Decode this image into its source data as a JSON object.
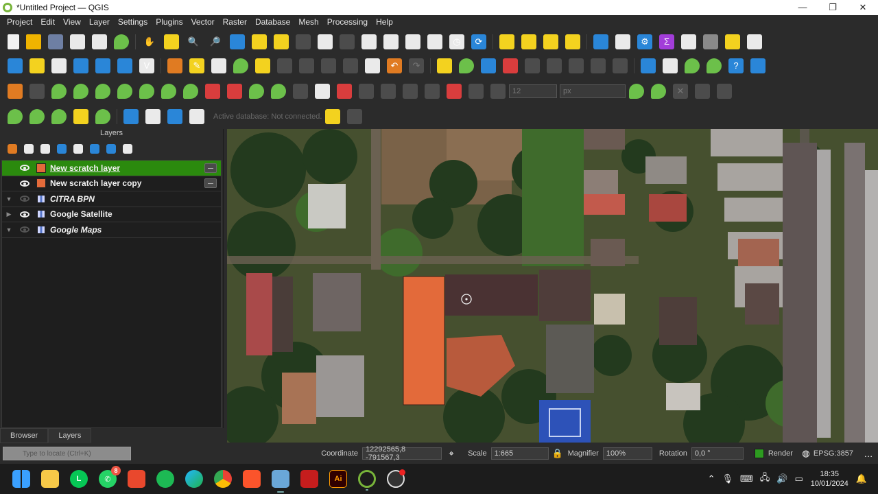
{
  "window": {
    "title": "*Untitled Project — QGIS",
    "min": "—",
    "max": "❐",
    "close": "✕"
  },
  "menu": [
    "Project",
    "Edit",
    "View",
    "Layer",
    "Settings",
    "Plugins",
    "Vector",
    "Raster",
    "Database",
    "Mesh",
    "Processing",
    "Help"
  ],
  "toolbar": {
    "spin_value": "12",
    "unit_value": "px",
    "active_database": "Active database: Not connected."
  },
  "layers_panel": {
    "title": "Layers",
    "layers": [
      {
        "name": "New scratch layer",
        "visible": true,
        "selected": true,
        "symbol": "orange",
        "editable": true,
        "italic": false
      },
      {
        "name": "New scratch layer copy",
        "visible": true,
        "selected": false,
        "symbol": "orange",
        "editable": true,
        "italic": false
      },
      {
        "name": "CITRA BPN",
        "visible": false,
        "selected": false,
        "symbol": "raster",
        "editable": false,
        "italic": true
      },
      {
        "name": "Google Satellite",
        "visible": true,
        "selected": false,
        "symbol": "raster",
        "editable": false,
        "italic": false
      },
      {
        "name": "Google Maps",
        "visible": false,
        "selected": false,
        "symbol": "raster",
        "editable": false,
        "italic": true
      }
    ]
  },
  "tabs": {
    "browser": "Browser",
    "layers": "Layers"
  },
  "statusbar": {
    "locator_placeholder": "Type to locate (Ctrl+K)",
    "coordinate_label": "Coordinate",
    "coordinate_value": "12292565,8 -791567,3",
    "scale_label": "Scale",
    "scale_value": "1:665",
    "magnifier_label": "Magnifier",
    "magnifier_value": "100%",
    "rotation_label": "Rotation",
    "rotation_value": "0,0 °",
    "render_label": "Render",
    "crs_label": "EPSG:3857"
  },
  "taskbar": {
    "whatsapp_badge": "8",
    "time": "18:35",
    "date": "10/01/2024"
  },
  "colors": {
    "selected_layer": "#2b8a0e",
    "scratch_fill": "#e36a3a",
    "render_on": "#2d9b20"
  }
}
